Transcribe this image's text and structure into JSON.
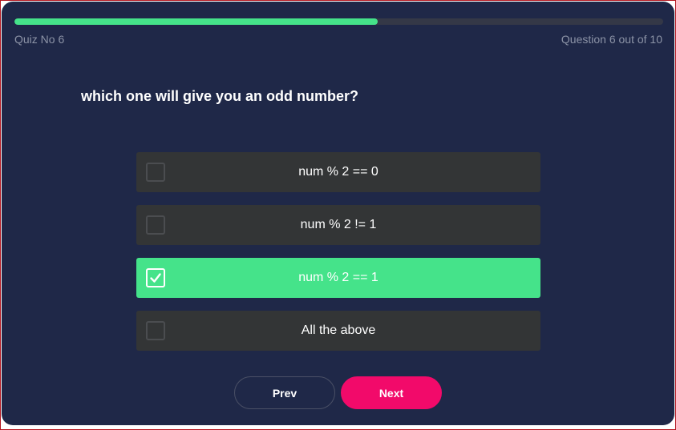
{
  "progress": {
    "fraction": 0.56,
    "color": "#45e38a"
  },
  "header": {
    "quiz_label": "Quiz No 6",
    "counter_label": "Question 6 out of 10"
  },
  "question": {
    "text": "which one will give you an odd number?"
  },
  "options": [
    {
      "label": "num % 2 == 0",
      "selected": false
    },
    {
      "label": "num % 2 != 1",
      "selected": false
    },
    {
      "label": "num % 2 == 1",
      "selected": true
    },
    {
      "label": "All the above",
      "selected": false
    }
  ],
  "nav": {
    "prev_label": "Prev",
    "next_label": "Next"
  },
  "colors": {
    "background": "#1f2848",
    "option": "#333536",
    "selected": "#45e38a",
    "next": "#f20a6a"
  }
}
